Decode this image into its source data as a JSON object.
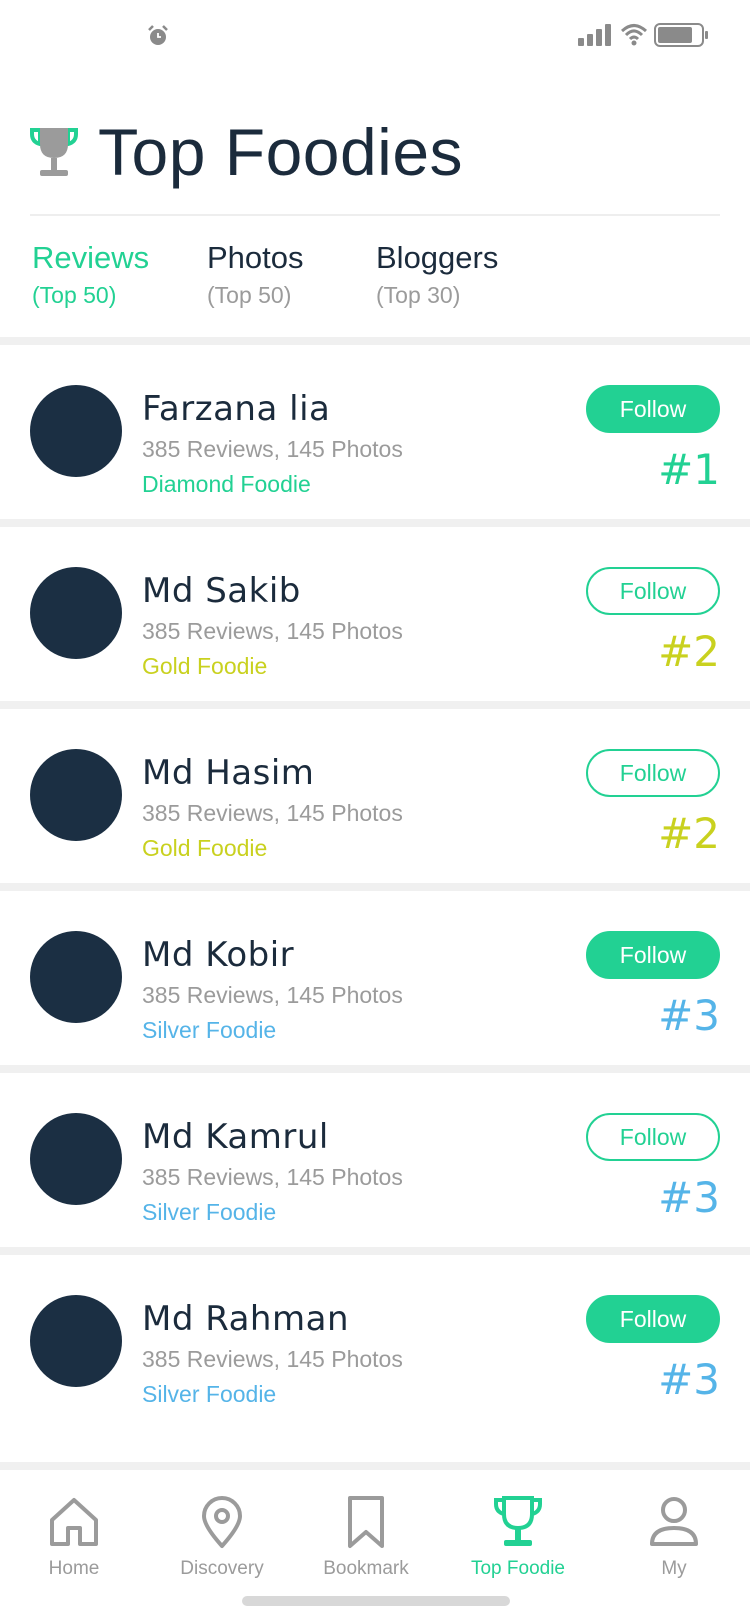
{
  "header": {
    "title": "Top Foodies"
  },
  "tabs": [
    {
      "label": "Reviews",
      "sub": "(Top 50)",
      "active": true
    },
    {
      "label": "Photos",
      "sub": "(Top 50)",
      "active": false
    },
    {
      "label": "Bloggers",
      "sub": "(Top 30)",
      "active": false
    }
  ],
  "foodies": [
    {
      "name": "Farzana lia",
      "stats": "385 Reviews, 145 Photos",
      "tier": "Diamond Foodie",
      "tier_color": "#22d193",
      "follow_label": "Follow",
      "follow_style": "filled",
      "rank": "#1",
      "rank_color": "#22d193"
    },
    {
      "name": "Md Sakib",
      "stats": "385 Reviews, 145 Photos",
      "tier": "Gold Foodie",
      "tier_color": "#c9d11f",
      "follow_label": "Follow",
      "follow_style": "outline",
      "rank": "#2",
      "rank_color": "#c9d11f"
    },
    {
      "name": "Md Hasim",
      "stats": "385 Reviews, 145 Photos",
      "tier": "Gold Foodie",
      "tier_color": "#c9d11f",
      "follow_label": "Follow",
      "follow_style": "outline",
      "rank": "#2",
      "rank_color": "#c9d11f"
    },
    {
      "name": "Md Kobir",
      "stats": "385 Reviews, 145 Photos",
      "tier": "Silver Foodie",
      "tier_color": "#55b4e8",
      "follow_label": "Follow",
      "follow_style": "filled",
      "rank": "#3",
      "rank_color": "#55b4e8"
    },
    {
      "name": "Md Kamrul",
      "stats": "385 Reviews, 145 Photos",
      "tier": "Silver Foodie",
      "tier_color": "#55b4e8",
      "follow_label": "Follow",
      "follow_style": "outline",
      "rank": "#3",
      "rank_color": "#55b4e8"
    },
    {
      "name": "Md Rahman",
      "stats": "385 Reviews, 145 Photos",
      "tier": "Silver Foodie",
      "tier_color": "#55b4e8",
      "follow_label": "Follow",
      "follow_style": "filled",
      "rank": "#3",
      "rank_color": "#55b4e8"
    }
  ],
  "nav": [
    {
      "label": "Home",
      "icon": "home-icon",
      "active": false
    },
    {
      "label": "Discovery",
      "icon": "location-pin-icon",
      "active": false
    },
    {
      "label": "Bookmark",
      "icon": "bookmark-icon",
      "active": false
    },
    {
      "label": "Top Foodie",
      "icon": "trophy-icon",
      "active": true
    },
    {
      "label": "My",
      "icon": "user-icon",
      "active": false
    }
  ],
  "colors": {
    "accent": "#22d193",
    "gold": "#c9d11f",
    "silver": "#55b4e8",
    "navy": "#1b2b3c"
  }
}
